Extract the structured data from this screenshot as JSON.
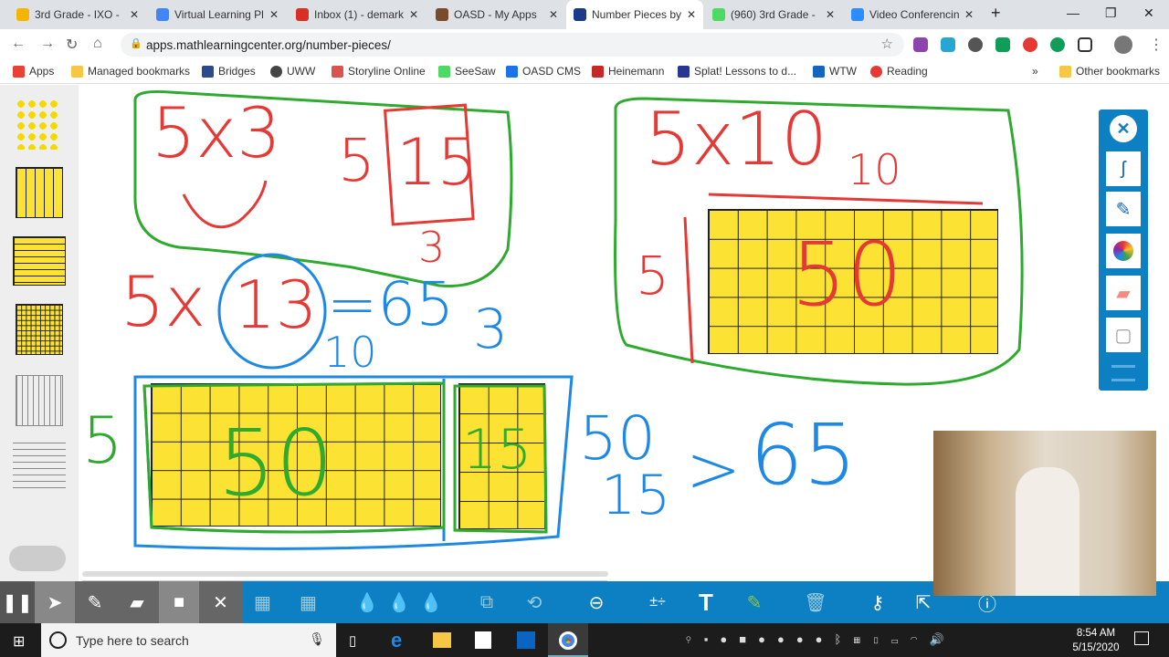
{
  "browser": {
    "tabs": [
      {
        "title": "3rd Grade - IXO -",
        "color": "#f4b400"
      },
      {
        "title": "Virtual Learning Pl",
        "color": "#4285f4"
      },
      {
        "title": "Inbox (1) - demark",
        "color": "#d93025"
      },
      {
        "title": "OASD - My Apps",
        "color": "#7a4b2a"
      },
      {
        "title": "Number Pieces by",
        "color": "#1a3a8a"
      },
      {
        "title": "(960) 3rd Grade -",
        "color": "#4cd964"
      },
      {
        "title": "Video Conferencin",
        "color": "#2d8cff"
      }
    ],
    "active_tab": 4,
    "new_tab": "+",
    "url": "apps.mathlearningcenter.org/number-pieces/",
    "bookmarks": [
      {
        "label": "Apps",
        "color": "#e94235"
      },
      {
        "label": "Managed bookmarks",
        "color": "#f6c744"
      },
      {
        "label": "Bridges",
        "color": "#2a4a8a"
      },
      {
        "label": "UWW",
        "color": "#444"
      },
      {
        "label": "Storyline Online",
        "color": "#d9534f"
      },
      {
        "label": "SeeSaw",
        "color": "#4cd964"
      },
      {
        "label": "OASD CMS",
        "color": "#1a73e8"
      },
      {
        "label": "Heinemann",
        "color": "#c62828"
      },
      {
        "label": "Splat! Lessons to d...",
        "color": "#283593"
      },
      {
        "label": "WTW",
        "color": "#1565c0"
      },
      {
        "label": "Reading",
        "color": "#e53935"
      }
    ],
    "bookmarks_more": "»",
    "other_bookmarks": "Other bookmarks"
  },
  "annotations": {
    "top_left": {
      "expr": "5x3",
      "side": "5",
      "product": "15",
      "bottom": "3"
    },
    "middle": {
      "expr_a": "5x",
      "circled": "13",
      "equals": "=65",
      "three": "3",
      "ten": "10"
    },
    "bottom_left": {
      "side": "5",
      "big": "50",
      "small": "15"
    },
    "sum": {
      "a": "50",
      "b": "15",
      "arrow": ">",
      "result": "65"
    },
    "top_right": {
      "expr": "5x10",
      "top": "10",
      "side": "5",
      "product": "50"
    }
  },
  "colors": {
    "accent": "#0d7fc3",
    "pieces": "#fbe233",
    "red_ink": "#e53935",
    "blue_ink": "#1e88e5",
    "green_ink": "#2eaa2e"
  },
  "right_tools": [
    "close-icon",
    "pen-style-icon",
    "pen-icon",
    "color-wheel-icon",
    "eraser-icon",
    "clear-icon",
    "menu-icon"
  ],
  "toolbar": [
    "pause",
    "select",
    "pen",
    "highlighter",
    "video",
    "close",
    "grid-right",
    "grid-left",
    "drop-green",
    "drop-teal",
    "drop-purple",
    "duplicate",
    "rotate",
    "zoom-out",
    "operations",
    "text",
    "marker",
    "trash",
    "key",
    "share",
    "info"
  ],
  "taskbar": {
    "search_placeholder": "Type here to search",
    "time": "8:54 AM",
    "date": "5/15/2020"
  }
}
